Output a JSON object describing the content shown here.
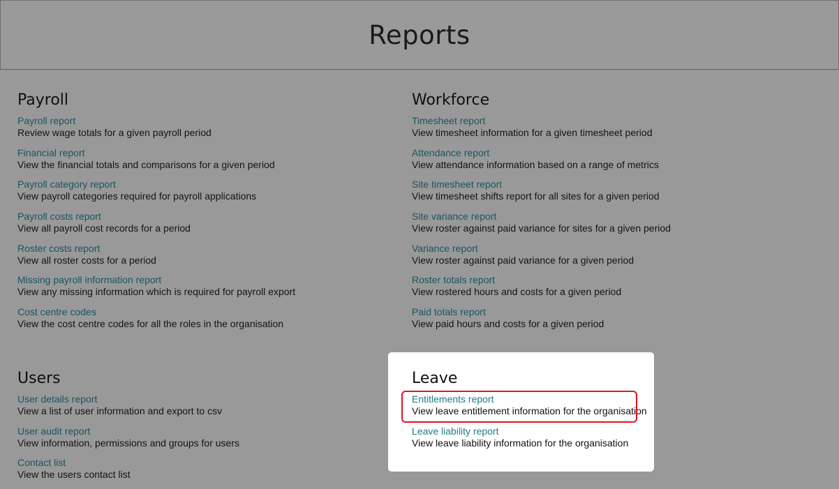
{
  "header": {
    "title": "Reports"
  },
  "sections": {
    "payroll": {
      "title": "Payroll",
      "items": [
        {
          "label": "Payroll report",
          "description": "Review wage totals for a given payroll period"
        },
        {
          "label": "Financial report",
          "description": "View the financial totals and comparisons for a given period"
        },
        {
          "label": "Payroll category report",
          "description": "View payroll categories required for payroll applications"
        },
        {
          "label": "Payroll costs report",
          "description": "View all payroll cost records for a period"
        },
        {
          "label": "Roster costs report",
          "description": "View all roster costs for a period"
        },
        {
          "label": "Missing payroll information report",
          "description": "View any missing information which is required for payroll export"
        },
        {
          "label": "Cost centre codes",
          "description": "View the cost centre codes for all the roles in the organisation"
        }
      ]
    },
    "workforce": {
      "title": "Workforce",
      "items": [
        {
          "label": "Timesheet report",
          "description": "View timesheet information for a given timesheet period"
        },
        {
          "label": "Attendance report",
          "description": "View attendance information based on a range of metrics"
        },
        {
          "label": "Site timesheet report",
          "description": "View timesheet shifts report for all sites for a given period"
        },
        {
          "label": "Site variance report",
          "description": "View roster against paid variance for sites for a given period"
        },
        {
          "label": "Variance report",
          "description": "View roster against paid variance for a given period"
        },
        {
          "label": "Roster totals report",
          "description": "View rostered hours and costs for a given period"
        },
        {
          "label": "Paid totals report",
          "description": "View paid hours and costs for a given period"
        }
      ]
    },
    "users": {
      "title": "Users",
      "items": [
        {
          "label": "User details report",
          "description": "View a list of user information and export to csv"
        },
        {
          "label": "User audit report",
          "description": "View information, permissions and groups for users"
        },
        {
          "label": "Contact list",
          "description": "View the users contact list"
        }
      ]
    },
    "leave": {
      "title": "Leave",
      "items": [
        {
          "label": "Entitlements report",
          "description": "View leave entitlement information for the organisation"
        },
        {
          "label": "Leave liability report",
          "description": "View leave liability information for the organisation"
        }
      ]
    }
  },
  "colors": {
    "overlay_background": "#999999",
    "link": "#1a5560",
    "link_highlighted": "#1e7a8a",
    "highlight_border": "#e0141e",
    "card_background": "#ffffff"
  }
}
